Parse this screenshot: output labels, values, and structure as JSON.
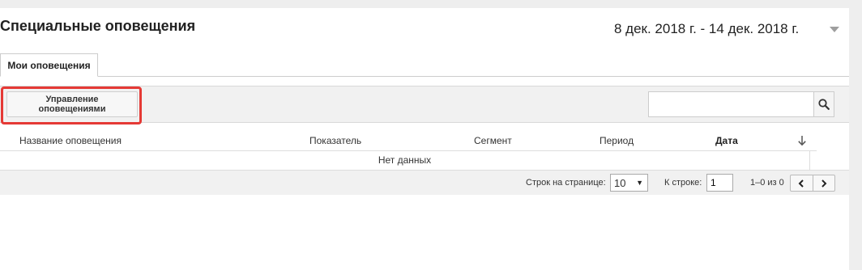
{
  "header": {
    "title": "Специальные оповещения",
    "date_range": "8 дек. 2018 г. - 14 дек. 2018 г."
  },
  "tabs": [
    {
      "label": "Мои оповещения",
      "active": true
    }
  ],
  "toolbar": {
    "manage_label": "Управление оповещениями",
    "search_value": "",
    "highlight_color": "#e53935"
  },
  "table": {
    "columns": [
      "Название оповещения",
      "Показатель",
      "Сегмент",
      "Период",
      "Дата"
    ],
    "sorted_column": "Дата",
    "sort_direction": "descending",
    "empty_text": "Нет данных"
  },
  "pagination": {
    "rows_label": "Строк на странице:",
    "rows_value": "10",
    "goto_label": "К строке:",
    "goto_value": "1",
    "range_text": "1–0 из 0"
  },
  "icons": {
    "search": "search-icon",
    "date_caret": "caret-down-icon",
    "sort": "arrow-down-icon",
    "prev": "chevron-left-icon",
    "next": "chevron-right-icon"
  }
}
